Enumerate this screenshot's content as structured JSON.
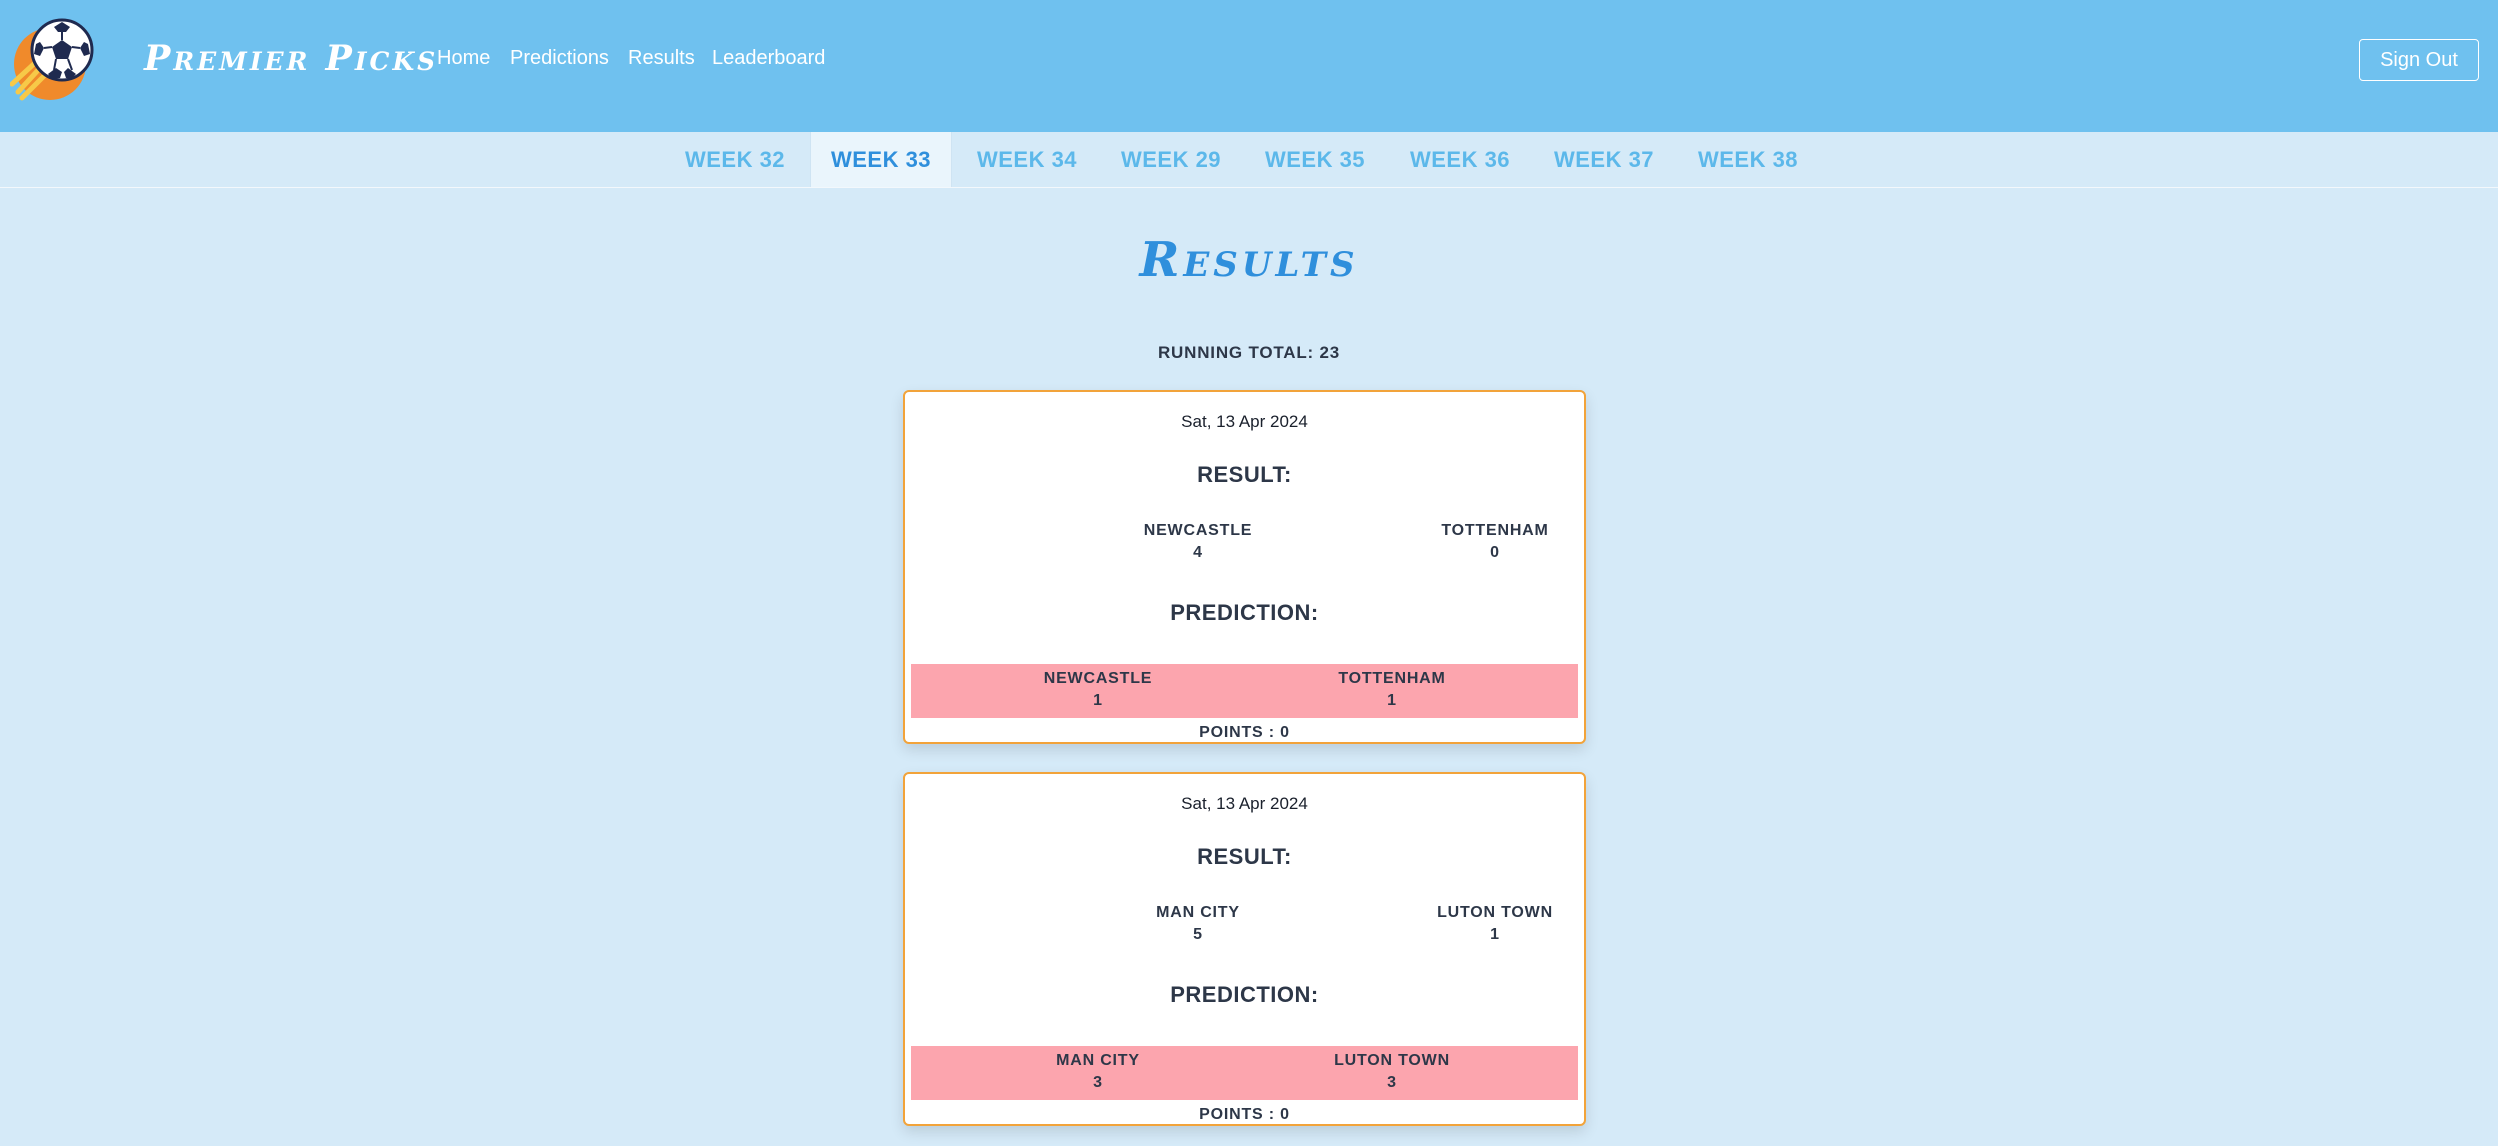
{
  "app": {
    "brand": "Premier Picks",
    "nav": [
      "Home",
      "Predictions",
      "Results",
      "Leaderboard"
    ],
    "sign_out": "Sign Out"
  },
  "tabs": {
    "items": [
      "WEEK 32",
      "WEEK 33",
      "WEEK 34",
      "WEEK 29",
      "WEEK 35",
      "WEEK 36",
      "WEEK 37",
      "WEEK 38"
    ],
    "active_index": 1
  },
  "page": {
    "title": "Results",
    "running_total": "RUNNING TOTAL: 23"
  },
  "labels": {
    "result": "RESULT:",
    "prediction": "PREDICTION:"
  },
  "matches": [
    {
      "date": "Sat, 13 Apr 2024",
      "result": {
        "home": "NEWCASTLE",
        "home_score": "4",
        "away": "TOTTENHAM",
        "away_score": "0"
      },
      "prediction": {
        "home": "NEWCASTLE",
        "home_score": "1",
        "away": "TOTTENHAM",
        "away_score": "1"
      },
      "points": "POINTS : 0"
    },
    {
      "date": "Sat, 13 Apr 2024",
      "result": {
        "home": "MAN CITY",
        "home_score": "5",
        "away": "LUTON TOWN",
        "away_score": "1"
      },
      "prediction": {
        "home": "MAN CITY",
        "home_score": "3",
        "away": "LUTON TOWN",
        "away_score": "3"
      },
      "points": "POINTS : 0"
    }
  ],
  "colors": {
    "header": "#6fc1ef",
    "background": "#d5eaf8",
    "accent": "#2f8fdc",
    "card_border": "#f2a33a",
    "prediction_band": "#fca5ae"
  },
  "icons": {
    "logo": "soccer-ball-icon"
  }
}
